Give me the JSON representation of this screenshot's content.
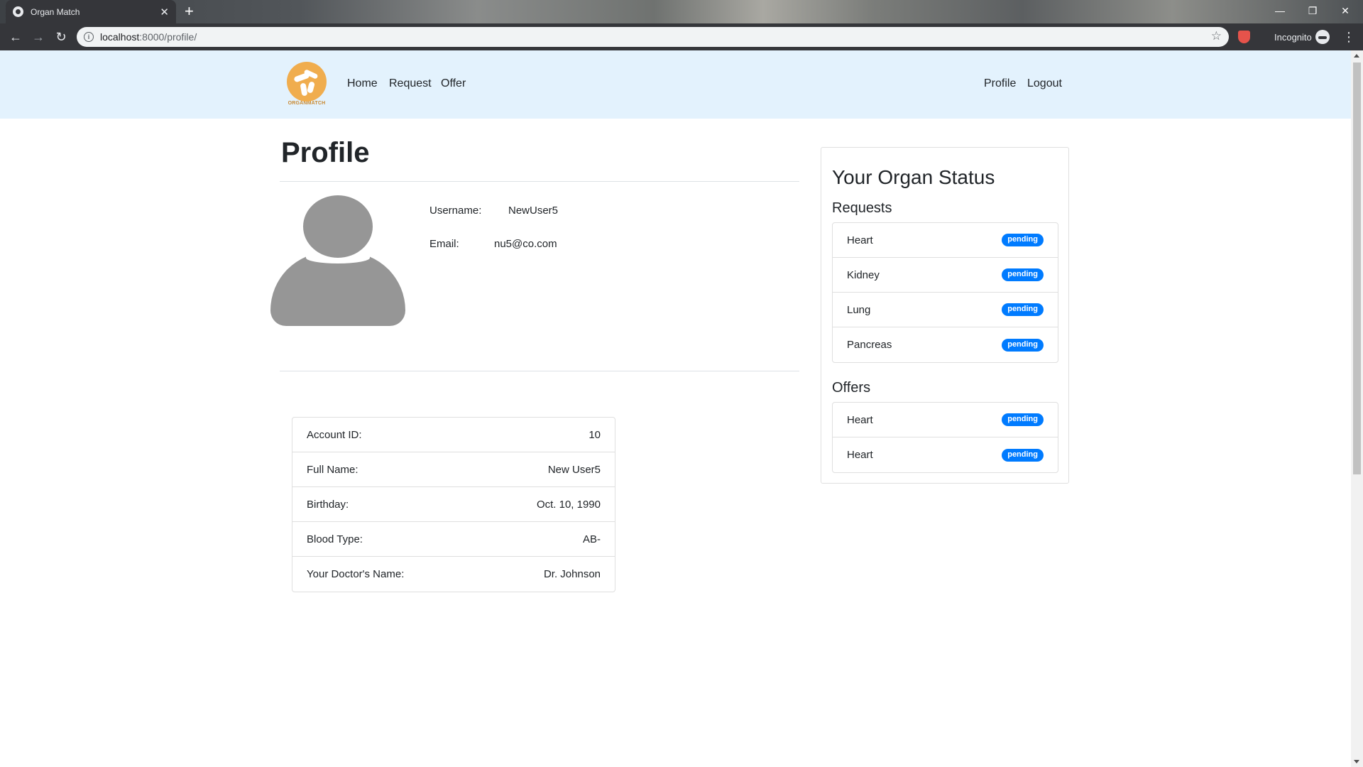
{
  "browser": {
    "tab_title": "Organ Match",
    "tab_close": "✕",
    "new_tab": "+",
    "url_host": "localhost",
    "url_rest": ":8000/profile/",
    "incognito_label": "Incognito",
    "window_controls": {
      "minimize": "—",
      "restore": "❐",
      "close": "✕"
    },
    "nav": {
      "back": "←",
      "forward": "→",
      "reload": "↻"
    },
    "star": "☆",
    "menu": "⋮",
    "info": "i"
  },
  "site": {
    "logo_text": "ORGANMATCH",
    "nav_left": [
      "Home",
      "Request",
      "Offer"
    ],
    "nav_right": [
      "Profile",
      "Logout"
    ],
    "brand_color": "#f0ad4e",
    "navbar_bg": "#e3f2fd"
  },
  "profile": {
    "title": "Profile",
    "username_label": "Username:",
    "username": "NewUser5",
    "email_label": "Email:",
    "email": "nu5@co.com"
  },
  "account": [
    {
      "label": "Account ID:",
      "value": "10"
    },
    {
      "label": "Full Name:",
      "value": "New User5"
    },
    {
      "label": "Birthday:",
      "value": "Oct. 10, 1990"
    },
    {
      "label": "Blood Type:",
      "value": "AB-"
    },
    {
      "label": "Your Doctor's Name:",
      "value": "Dr. Johnson"
    }
  ],
  "organ_status": {
    "title": "Your Organ Status",
    "requests_title": "Requests",
    "requests": [
      {
        "organ": "Heart",
        "status": "pending"
      },
      {
        "organ": "Kidney",
        "status": "pending"
      },
      {
        "organ": "Lung",
        "status": "pending"
      },
      {
        "organ": "Pancreas",
        "status": "pending"
      }
    ],
    "offers_title": "Offers",
    "offers": [
      {
        "organ": "Heart",
        "status": "pending"
      },
      {
        "organ": "Heart",
        "status": "pending"
      }
    ],
    "badge_color": "#007bff"
  }
}
